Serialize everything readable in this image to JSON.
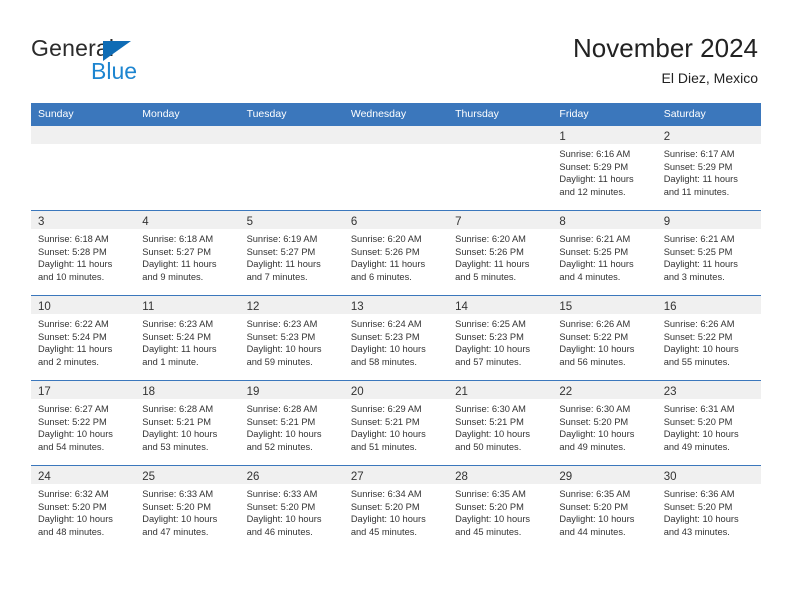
{
  "brand": {
    "name_top": "General",
    "name_bottom": "Blue",
    "triangle_color": "#0f6cb5",
    "blue_color": "#1d85d0"
  },
  "header": {
    "title": "November 2024",
    "subtitle": "El Diez, Mexico"
  },
  "theme": {
    "header_bg": "#3b77bc",
    "daynum_band_bg": "#f0f0f0",
    "row_divider": "#3b77bc",
    "text": "#333333"
  },
  "weekdays": [
    "Sunday",
    "Monday",
    "Tuesday",
    "Wednesday",
    "Thursday",
    "Friday",
    "Saturday"
  ],
  "weeks": [
    [
      {
        "day": "",
        "lines": []
      },
      {
        "day": "",
        "lines": []
      },
      {
        "day": "",
        "lines": []
      },
      {
        "day": "",
        "lines": []
      },
      {
        "day": "",
        "lines": []
      },
      {
        "day": "1",
        "lines": [
          "Sunrise: 6:16 AM",
          "Sunset: 5:29 PM",
          "Daylight: 11 hours",
          "and 12 minutes."
        ]
      },
      {
        "day": "2",
        "lines": [
          "Sunrise: 6:17 AM",
          "Sunset: 5:29 PM",
          "Daylight: 11 hours",
          "and 11 minutes."
        ]
      }
    ],
    [
      {
        "day": "3",
        "lines": [
          "Sunrise: 6:18 AM",
          "Sunset: 5:28 PM",
          "Daylight: 11 hours",
          "and 10 minutes."
        ]
      },
      {
        "day": "4",
        "lines": [
          "Sunrise: 6:18 AM",
          "Sunset: 5:27 PM",
          "Daylight: 11 hours",
          "and 9 minutes."
        ]
      },
      {
        "day": "5",
        "lines": [
          "Sunrise: 6:19 AM",
          "Sunset: 5:27 PM",
          "Daylight: 11 hours",
          "and 7 minutes."
        ]
      },
      {
        "day": "6",
        "lines": [
          "Sunrise: 6:20 AM",
          "Sunset: 5:26 PM",
          "Daylight: 11 hours",
          "and 6 minutes."
        ]
      },
      {
        "day": "7",
        "lines": [
          "Sunrise: 6:20 AM",
          "Sunset: 5:26 PM",
          "Daylight: 11 hours",
          "and 5 minutes."
        ]
      },
      {
        "day": "8",
        "lines": [
          "Sunrise: 6:21 AM",
          "Sunset: 5:25 PM",
          "Daylight: 11 hours",
          "and 4 minutes."
        ]
      },
      {
        "day": "9",
        "lines": [
          "Sunrise: 6:21 AM",
          "Sunset: 5:25 PM",
          "Daylight: 11 hours",
          "and 3 minutes."
        ]
      }
    ],
    [
      {
        "day": "10",
        "lines": [
          "Sunrise: 6:22 AM",
          "Sunset: 5:24 PM",
          "Daylight: 11 hours",
          "and 2 minutes."
        ]
      },
      {
        "day": "11",
        "lines": [
          "Sunrise: 6:23 AM",
          "Sunset: 5:24 PM",
          "Daylight: 11 hours",
          "and 1 minute."
        ]
      },
      {
        "day": "12",
        "lines": [
          "Sunrise: 6:23 AM",
          "Sunset: 5:23 PM",
          "Daylight: 10 hours",
          "and 59 minutes."
        ]
      },
      {
        "day": "13",
        "lines": [
          "Sunrise: 6:24 AM",
          "Sunset: 5:23 PM",
          "Daylight: 10 hours",
          "and 58 minutes."
        ]
      },
      {
        "day": "14",
        "lines": [
          "Sunrise: 6:25 AM",
          "Sunset: 5:23 PM",
          "Daylight: 10 hours",
          "and 57 minutes."
        ]
      },
      {
        "day": "15",
        "lines": [
          "Sunrise: 6:26 AM",
          "Sunset: 5:22 PM",
          "Daylight: 10 hours",
          "and 56 minutes."
        ]
      },
      {
        "day": "16",
        "lines": [
          "Sunrise: 6:26 AM",
          "Sunset: 5:22 PM",
          "Daylight: 10 hours",
          "and 55 minutes."
        ]
      }
    ],
    [
      {
        "day": "17",
        "lines": [
          "Sunrise: 6:27 AM",
          "Sunset: 5:22 PM",
          "Daylight: 10 hours",
          "and 54 minutes."
        ]
      },
      {
        "day": "18",
        "lines": [
          "Sunrise: 6:28 AM",
          "Sunset: 5:21 PM",
          "Daylight: 10 hours",
          "and 53 minutes."
        ]
      },
      {
        "day": "19",
        "lines": [
          "Sunrise: 6:28 AM",
          "Sunset: 5:21 PM",
          "Daylight: 10 hours",
          "and 52 minutes."
        ]
      },
      {
        "day": "20",
        "lines": [
          "Sunrise: 6:29 AM",
          "Sunset: 5:21 PM",
          "Daylight: 10 hours",
          "and 51 minutes."
        ]
      },
      {
        "day": "21",
        "lines": [
          "Sunrise: 6:30 AM",
          "Sunset: 5:21 PM",
          "Daylight: 10 hours",
          "and 50 minutes."
        ]
      },
      {
        "day": "22",
        "lines": [
          "Sunrise: 6:30 AM",
          "Sunset: 5:20 PM",
          "Daylight: 10 hours",
          "and 49 minutes."
        ]
      },
      {
        "day": "23",
        "lines": [
          "Sunrise: 6:31 AM",
          "Sunset: 5:20 PM",
          "Daylight: 10 hours",
          "and 49 minutes."
        ]
      }
    ],
    [
      {
        "day": "24",
        "lines": [
          "Sunrise: 6:32 AM",
          "Sunset: 5:20 PM",
          "Daylight: 10 hours",
          "and 48 minutes."
        ]
      },
      {
        "day": "25",
        "lines": [
          "Sunrise: 6:33 AM",
          "Sunset: 5:20 PM",
          "Daylight: 10 hours",
          "and 47 minutes."
        ]
      },
      {
        "day": "26",
        "lines": [
          "Sunrise: 6:33 AM",
          "Sunset: 5:20 PM",
          "Daylight: 10 hours",
          "and 46 minutes."
        ]
      },
      {
        "day": "27",
        "lines": [
          "Sunrise: 6:34 AM",
          "Sunset: 5:20 PM",
          "Daylight: 10 hours",
          "and 45 minutes."
        ]
      },
      {
        "day": "28",
        "lines": [
          "Sunrise: 6:35 AM",
          "Sunset: 5:20 PM",
          "Daylight: 10 hours",
          "and 45 minutes."
        ]
      },
      {
        "day": "29",
        "lines": [
          "Sunrise: 6:35 AM",
          "Sunset: 5:20 PM",
          "Daylight: 10 hours",
          "and 44 minutes."
        ]
      },
      {
        "day": "30",
        "lines": [
          "Sunrise: 6:36 AM",
          "Sunset: 5:20 PM",
          "Daylight: 10 hours",
          "and 43 minutes."
        ]
      }
    ]
  ]
}
